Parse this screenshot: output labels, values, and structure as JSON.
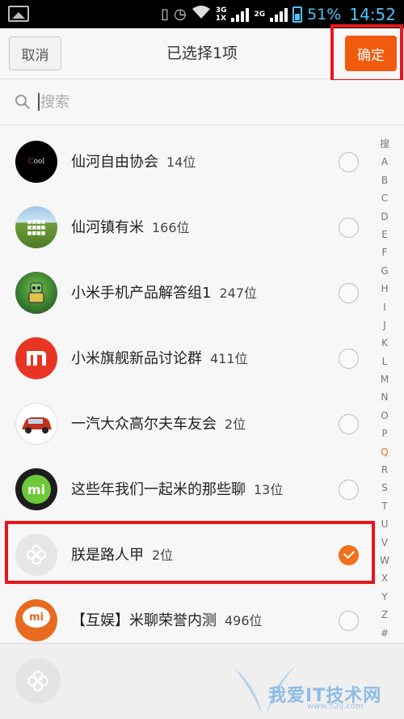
{
  "status_bar": {
    "net_top": "3G",
    "net_bottom": "1X",
    "net2": "2G",
    "battery_percent": "51%",
    "time": "14:52"
  },
  "header": {
    "cancel_label": "取消",
    "title": "已选择1项",
    "confirm_label": "确定"
  },
  "search": {
    "placeholder": "搜索"
  },
  "groups": [
    {
      "name": "仙河自由协会",
      "count": "14位",
      "checked": false,
      "avatar": "cool-logo"
    },
    {
      "name": "仙河镇有米",
      "count": "166位",
      "checked": false,
      "avatar": "landscape-photo"
    },
    {
      "name": "小米手机产品解答组1",
      "count": "247位",
      "checked": false,
      "avatar": "robot-illustration"
    },
    {
      "name": "小米旗舰新品讨论群",
      "count": "411位",
      "checked": false,
      "avatar": "mi-logo"
    },
    {
      "name": "一汽大众高尔夫车友会",
      "count": "2位",
      "checked": false,
      "avatar": "car-photo"
    },
    {
      "name": "这些年我们一起米的那些聊",
      "count": "13位",
      "checked": false,
      "avatar": "mi-green-logo"
    },
    {
      "name": "朕是路人甲",
      "count": "2位",
      "checked": true,
      "avatar": "default-avatar"
    },
    {
      "name": "【互娱】米聊荣誉内测",
      "count": "496位",
      "checked": false,
      "avatar": "mi-chat-logo"
    }
  ],
  "index_letters": [
    "搜",
    "A",
    "B",
    "C",
    "D",
    "E",
    "F",
    "G",
    "H",
    "I",
    "J",
    "K",
    "L",
    "M",
    "N",
    "O",
    "P",
    "Q",
    "R",
    "S",
    "T",
    "U",
    "V",
    "W",
    "X",
    "Y",
    "Z",
    "#"
  ],
  "index_active": "Q",
  "watermark": {
    "text": "我爱IT技术网",
    "url": "www.52ij.com"
  },
  "colors": {
    "accent": "#f25a0e",
    "check": "#f0701c",
    "annotation": "#e8161b"
  }
}
